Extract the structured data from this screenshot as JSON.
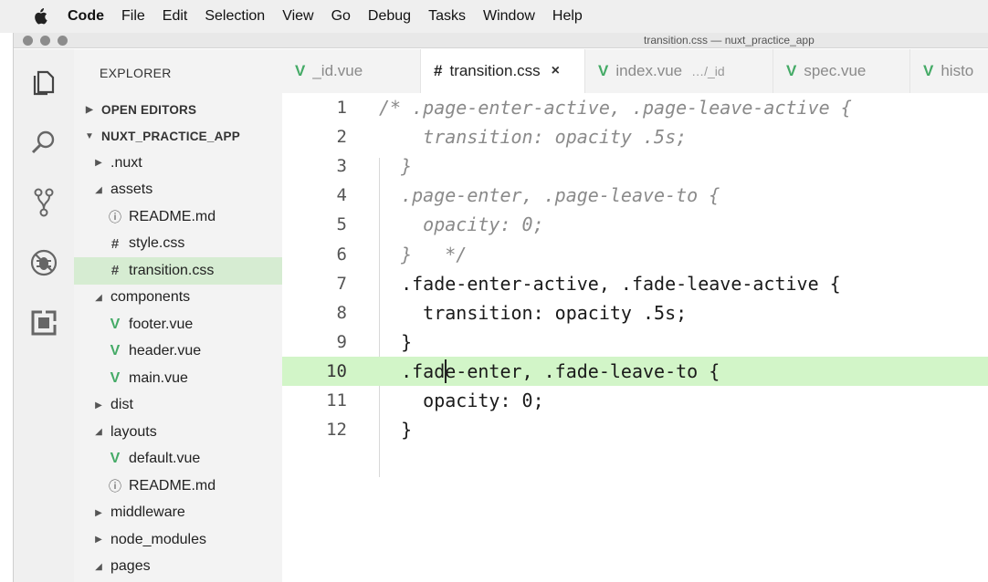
{
  "menubar": {
    "app": "Code",
    "items": [
      "File",
      "Edit",
      "Selection",
      "View",
      "Go",
      "Debug",
      "Tasks",
      "Window",
      "Help"
    ]
  },
  "window": {
    "title": "transition.css — nuxt_practice_app"
  },
  "sidebar": {
    "header": "EXPLORER",
    "open_editors": "OPEN EDITORS",
    "project": "NUXT_PRACTICE_APP",
    "items": [
      {
        "label": ".nuxt",
        "kind": "folder",
        "open": false
      },
      {
        "label": "assets",
        "kind": "folder",
        "open": true
      },
      {
        "label": "README.md",
        "kind": "info"
      },
      {
        "label": "style.css",
        "kind": "css"
      },
      {
        "label": "transition.css",
        "kind": "css",
        "selected": true
      },
      {
        "label": "components",
        "kind": "folder",
        "open": true
      },
      {
        "label": "footer.vue",
        "kind": "vue"
      },
      {
        "label": "header.vue",
        "kind": "vue"
      },
      {
        "label": "main.vue",
        "kind": "vue"
      },
      {
        "label": "dist",
        "kind": "folder",
        "open": false
      },
      {
        "label": "layouts",
        "kind": "folder",
        "open": true
      },
      {
        "label": "default.vue",
        "kind": "vue"
      },
      {
        "label": "README.md",
        "kind": "info"
      },
      {
        "label": "middleware",
        "kind": "folder",
        "open": false
      },
      {
        "label": "node_modules",
        "kind": "folder",
        "open": false
      },
      {
        "label": "pages",
        "kind": "folder",
        "open": true
      }
    ]
  },
  "tabs": [
    {
      "label": "_id.vue",
      "icon": "V",
      "desc": ""
    },
    {
      "label": "transition.css",
      "icon": "#",
      "desc": "",
      "active": true,
      "close": "×"
    },
    {
      "label": "index.vue",
      "icon": "V",
      "desc": "…/_id"
    },
    {
      "label": "spec.vue",
      "icon": "V",
      "desc": ""
    },
    {
      "label": "histo",
      "icon": "V",
      "desc": ""
    }
  ],
  "editor": {
    "current_line": 10,
    "lines": [
      {
        "n": "1",
        "text": "/* .page-enter-active, .page-leave-active {",
        "comment": true
      },
      {
        "n": "2",
        "text": "    transition: opacity .5s;",
        "comment": true
      },
      {
        "n": "3",
        "text": "  }",
        "comment": true
      },
      {
        "n": "4",
        "text": "  .page-enter, .page-leave-to {",
        "comment": true
      },
      {
        "n": "5",
        "text": "    opacity: 0;",
        "comment": true
      },
      {
        "n": "6",
        "text": "  }   */",
        "comment": true
      },
      {
        "n": "7",
        "text": "  .fade-enter-active, .fade-leave-active {",
        "comment": false
      },
      {
        "n": "8",
        "text": "    transition: opacity .5s;",
        "comment": false
      },
      {
        "n": "9",
        "text": "  }",
        "comment": false
      },
      {
        "n": "10",
        "text": "  .fade-enter, .fade-leave-to {",
        "comment": false
      },
      {
        "n": "11",
        "text": "    opacity: 0;",
        "comment": false
      },
      {
        "n": "12",
        "text": "  }",
        "comment": false
      }
    ]
  },
  "colors": {
    "selection": "#d6ecd2",
    "current_line": "#d2f5c8",
    "vue_icon": "#44aa66"
  }
}
